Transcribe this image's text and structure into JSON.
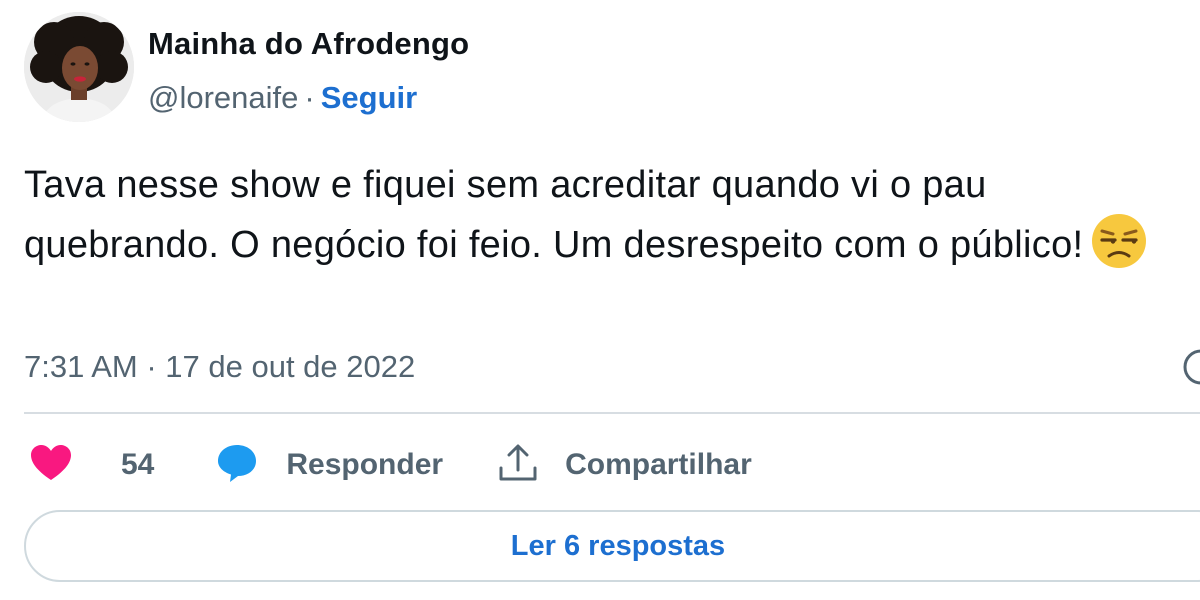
{
  "author": {
    "display_name": "Mainha do Afrodengo",
    "handle": "@lorenaife",
    "separator": "·",
    "follow_label": "Seguir",
    "avatar_icon": "profile-photo"
  },
  "tweet": {
    "text": "Tava nesse show e fiquei sem acreditar quando vi o pau quebrando. O negócio foi feio. Um desrespeito com o público!",
    "emoji": "unamused-face",
    "timestamp": "7:31 AM · 17 de out de 2022",
    "info_icon": "info-icon"
  },
  "actions": {
    "like": {
      "icon": "heart-icon",
      "count": "54",
      "color": "#f91880"
    },
    "reply": {
      "icon": "speech-bubble-icon",
      "label": "Responder",
      "color": "#1d9bf0"
    },
    "share": {
      "icon": "share-icon",
      "label": "Compartilhar"
    }
  },
  "replies_button": {
    "label": "Ler 6 respostas"
  },
  "colors": {
    "link": "#1d6fd0",
    "secondary_text": "#536471",
    "border": "#cfd9de"
  }
}
